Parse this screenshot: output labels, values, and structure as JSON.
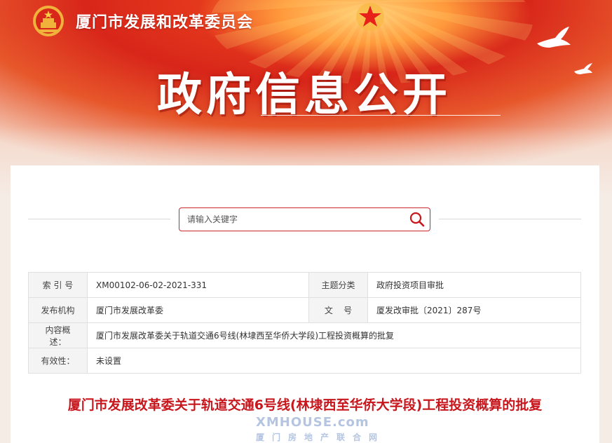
{
  "header": {
    "org_name": "厦门市发展和改革委员会",
    "hero_title": "政府信息公开"
  },
  "search": {
    "placeholder": "请输入关键字"
  },
  "meta_table": {
    "rows": [
      {
        "label1": "索 引 号",
        "value1": "XM00102-06-02-2021-331",
        "label2": "主题分类",
        "value2": "政府投资项目审批"
      },
      {
        "label1": "发布机构",
        "value1": "厦门市发展改革委",
        "label2": "文    号",
        "value2": "厦发改审批〔2021〕287号"
      },
      {
        "label1": "内容概述：",
        "value1": "厦门市发展改革委关于轨道交通6号线(林埭西至华侨大学段)工程投资概算的批复"
      },
      {
        "label1": "有效性：",
        "value1": "未设置"
      }
    ]
  },
  "document": {
    "title": "厦门市发展改革委关于轨道交通6号线(林埭西至华侨大学段)工程投资概算的批复"
  },
  "watermark": {
    "main": "XMHOUSE.com",
    "sub": "厦门房地产联合网"
  },
  "colors": {
    "brand_red": "#c8161d",
    "banner_red": "#d8261a",
    "gold": "#f6c64a"
  }
}
